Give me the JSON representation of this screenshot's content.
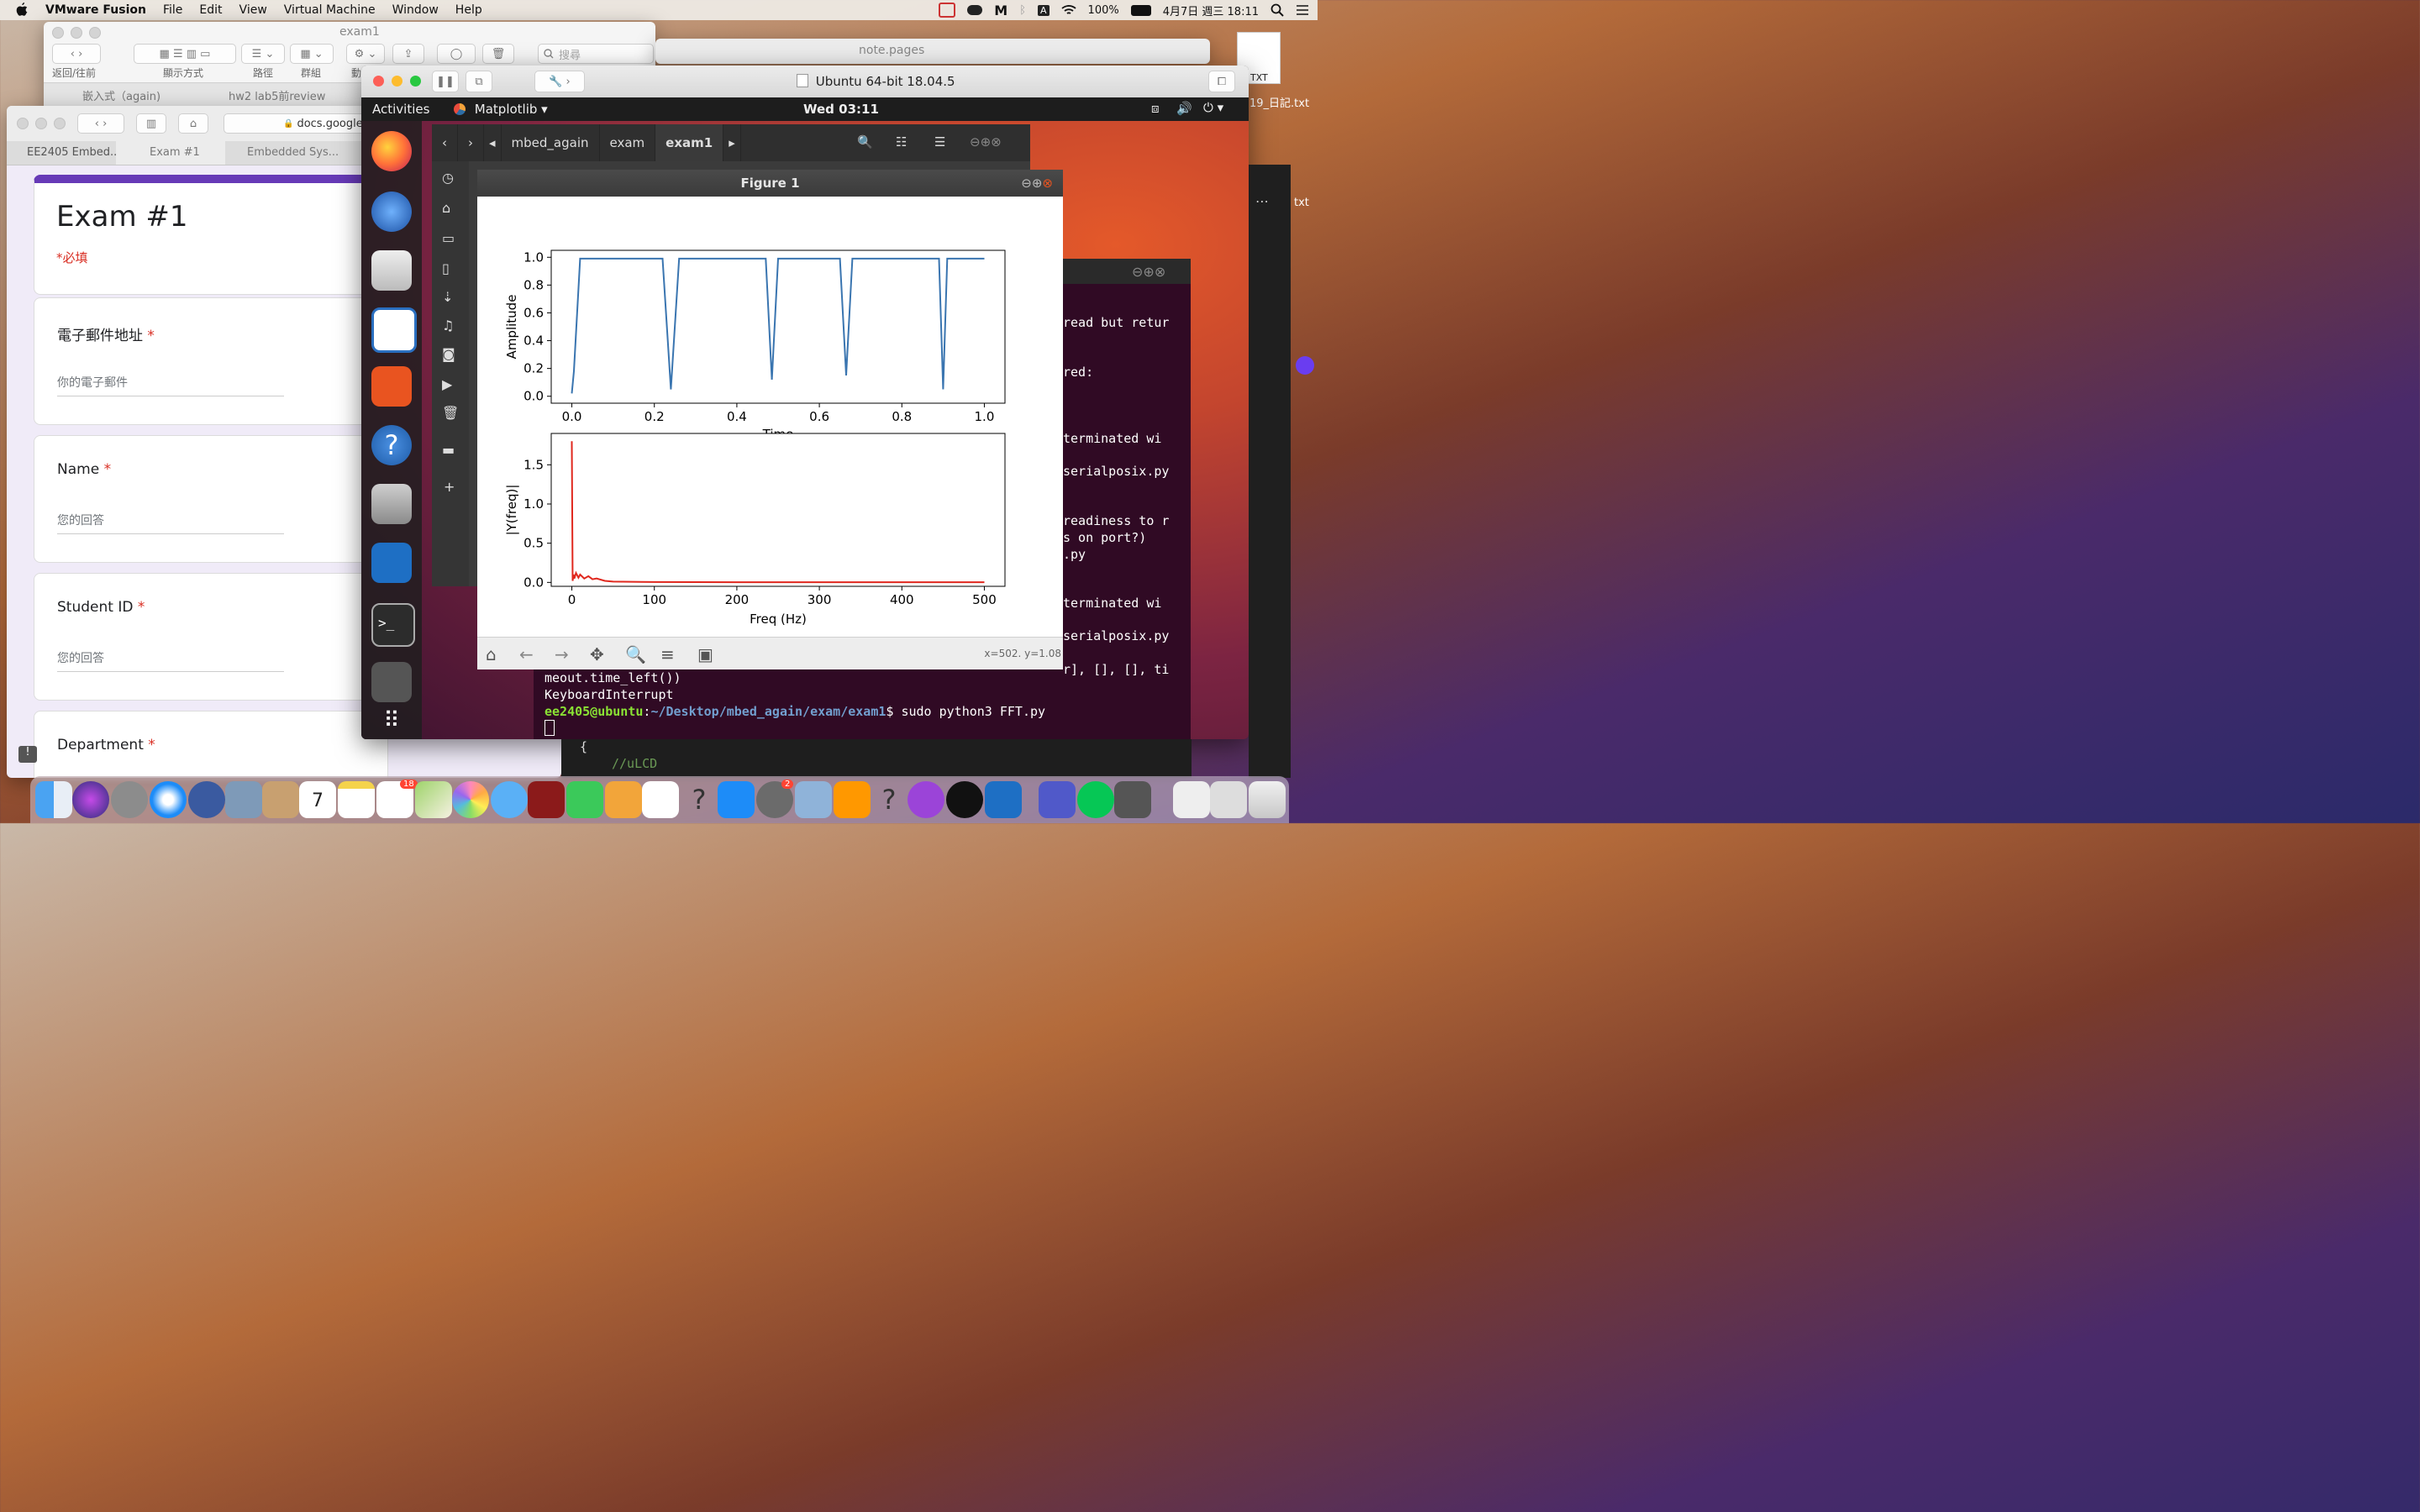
{
  "menubar": {
    "app": "VMware Fusion",
    "items": [
      "File",
      "Edit",
      "View",
      "Virtual Machine",
      "Window",
      "Help"
    ],
    "battery": "100%",
    "datetime": "4月7日 週三 18:11"
  },
  "finder": {
    "title": "exam1",
    "labels": [
      "返回/往前",
      "顯示方式",
      "路徑",
      "群組",
      "動"
    ],
    "search_placeholder": "搜尋",
    "tabs": [
      "嵌入式（again)",
      "hw2 lab5前review"
    ]
  },
  "notes_window": {
    "title": "note.pages"
  },
  "desktop_files": [
    "TXT",
    "19_日記.txt",
    "txt"
  ],
  "safari": {
    "url": "docs.google.",
    "tabs": [
      "EE2405 Embed...",
      "Exam #1",
      "Embedded Sys..."
    ]
  },
  "form": {
    "title": "Exam #1",
    "required_note": "*必填",
    "questions": [
      {
        "label": "電子郵件地址",
        "placeholder": "你的電子郵件"
      },
      {
        "label": "Name",
        "placeholder": "您的回答"
      },
      {
        "label": "Student ID",
        "placeholder": "您的回答"
      },
      {
        "label": "Department",
        "placeholder": ""
      }
    ],
    "required_mark": "*"
  },
  "vm": {
    "title": "Ubuntu 64-bit 18.04.5",
    "activities": "Activities",
    "app_menu": "Matplotlib",
    "clock": "Wed 03:11"
  },
  "files": {
    "breadcrumbs": [
      "mbed_again",
      "exam",
      "exam1"
    ]
  },
  "terminal": {
    "lines": [
      {
        "text": "read but retur",
        "top": 297
      },
      {
        "text": "red:",
        "top": 356
      },
      {
        "text": "terminated wi",
        "top": 435
      },
      {
        "text": "serialposix.py",
        "top": 474
      },
      {
        "text": "readiness to r",
        "top": 533
      },
      {
        "text": "s on port?)",
        "top": 553
      },
      {
        "text": ".py",
        "top": 573
      },
      {
        "text": "terminated wi",
        "top": 631
      },
      {
        "text": "serialposix.py",
        "top": 670
      },
      {
        "text": "r], [], [], ti",
        "top": 710
      }
    ],
    "line_timeout": "meout.time_left())",
    "line_interrupt": "KeyboardInterrupt",
    "prompt_user": "ee2405@ubuntu",
    "prompt_sep": ":",
    "prompt_path": "~/Desktop/mbed_again/exam/exam1",
    "prompt_cmd": "$ sudo python3 FFT.py"
  },
  "editor_peek": {
    "brace": "{",
    "comment": "//uLCD"
  },
  "figure": {
    "title": "Figure 1",
    "coords": "x=502. y=1.08"
  },
  "dock_badges": {
    "calendar_day": "7",
    "reminders": "18",
    "settings": "2"
  },
  "chart_data": [
    {
      "type": "line",
      "title": "",
      "xlabel": "Time",
      "ylabel": "Amplitude",
      "xlim": [
        -0.05,
        1.05
      ],
      "ylim": [
        -0.05,
        1.05
      ],
      "xticks": [
        "0.0",
        "0.2",
        "0.4",
        "0.6",
        "0.8",
        "1.0"
      ],
      "yticks": [
        "0.0",
        "0.2",
        "0.4",
        "0.6",
        "0.8",
        "1.0"
      ],
      "color": "#3a75b0",
      "series": [
        {
          "name": "",
          "x": [
            0.0,
            0.005,
            0.02,
            0.22,
            0.24,
            0.26,
            0.47,
            0.485,
            0.5,
            0.65,
            0.665,
            0.68,
            0.89,
            0.9,
            0.91,
            1.0
          ],
          "y": [
            0.02,
            0.18,
            0.99,
            0.99,
            0.05,
            0.99,
            0.99,
            0.12,
            0.99,
            0.99,
            0.15,
            0.99,
            0.99,
            0.05,
            0.99,
            0.99
          ]
        }
      ]
    },
    {
      "type": "line",
      "title": "",
      "xlabel": "Freq (Hz)",
      "ylabel": "|Y(freq)|",
      "xlim": [
        -25,
        525
      ],
      "ylim": [
        -0.05,
        1.9
      ],
      "xticks": [
        "0",
        "100",
        "200",
        "300",
        "400",
        "500"
      ],
      "yticks": [
        "0.0",
        "0.5",
        "1.0",
        "1.5"
      ],
      "color": "#e0281e",
      "series": [
        {
          "name": "",
          "x": [
            0,
            1,
            2,
            3,
            5,
            8,
            10,
            15,
            20,
            25,
            30,
            40,
            50,
            100,
            200,
            300,
            400,
            500
          ],
          "y": [
            1.8,
            0.02,
            0.1,
            0.05,
            0.12,
            0.06,
            0.1,
            0.05,
            0.08,
            0.04,
            0.05,
            0.02,
            0.01,
            0.005,
            0.003,
            0.003,
            0.003,
            0.003
          ]
        }
      ]
    }
  ]
}
